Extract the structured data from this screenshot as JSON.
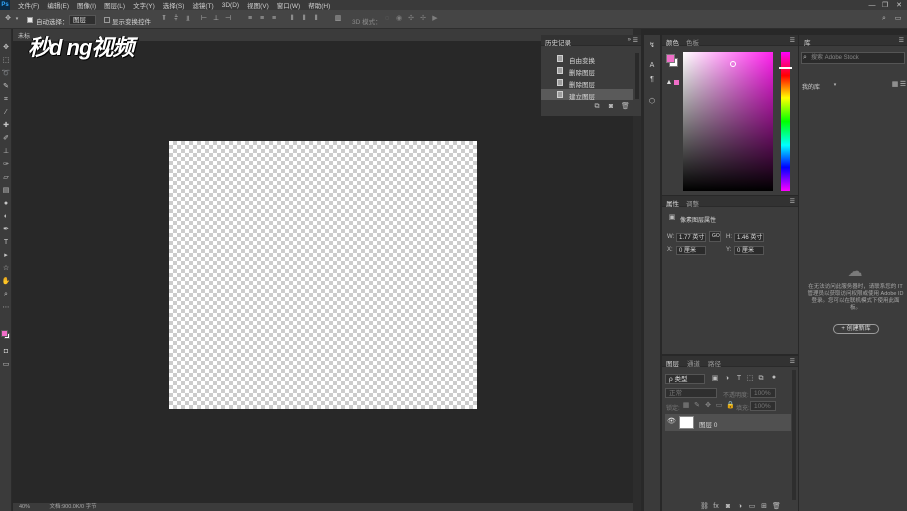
{
  "menubar": {
    "app_icon": "Ps",
    "items": [
      "文件(F)",
      "编辑(E)",
      "图像(I)",
      "图层(L)",
      "文字(Y)",
      "选择(S)",
      "滤镜(T)",
      "3D(D)",
      "视图(V)",
      "窗口(W)",
      "帮助(H)"
    ],
    "window_controls": [
      "—",
      "❐",
      "✕"
    ]
  },
  "options": {
    "auto_select_label": "自动选择：",
    "auto_select_value": "图层",
    "show_transform_label": "显示变换控件",
    "mode_3d_label": "3D 模式："
  },
  "document": {
    "tab_title": "未标",
    "status_left": "40%",
    "status_text": "文档:900.0K/0 字节"
  },
  "watermark": {
    "text": "秒d ng视频"
  },
  "history_panel": {
    "title": "历史记录",
    "items": [
      "自由变换",
      "删除图层",
      "删除图层",
      "建立图层"
    ]
  },
  "color_panel": {
    "tabs": [
      "颜色",
      "色板"
    ],
    "foreground": "#f06ec8",
    "background": "#ffffff"
  },
  "properties_panel": {
    "tabs": [
      "属性",
      "调整"
    ],
    "section_title": "像素图层属性",
    "w_label": "W:",
    "w_value": "1.77 英寸",
    "link_label": "GO",
    "h_label": "H:",
    "h_value": "1.46 英寸",
    "x_label": "X:",
    "x_value": "0 厘米",
    "y_label": "Y:",
    "y_value": "0 厘米"
  },
  "layers_panel": {
    "tabs": [
      "图层",
      "通道",
      "路径"
    ],
    "filter_label": "ρ 类型",
    "blend_mode": "正常",
    "opacity_label": "不透明度:",
    "opacity_value": "100%",
    "lock_label": "锁定:",
    "fill_label": "填充:",
    "fill_value": "100%",
    "layer_name": "图层 0"
  },
  "library_panel": {
    "title": "库",
    "search_placeholder": "搜索 Adobe Stock",
    "dropdown_label": "我的库",
    "message": "在无法访问此服务器时，请联系您的 IT 管理员以获取访问权限或使用 Adobe ID 登录。您可以在联机模式下使用此面板。",
    "create_button": "+ 创建新库"
  }
}
